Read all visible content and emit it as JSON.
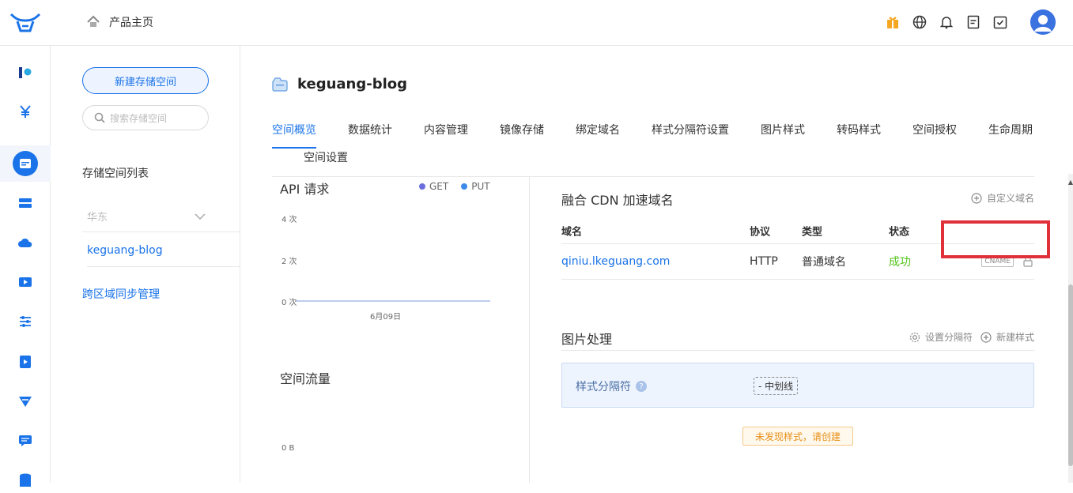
{
  "header": {
    "home_label": "产品主页",
    "icons": [
      "gift-icon",
      "globe-icon",
      "bell-icon",
      "document-icon",
      "task-check-icon",
      "user-avatar"
    ]
  },
  "rail": {
    "icons": [
      "kodo-logo-icon",
      "yuan-icon",
      "storage-icon",
      "server-icon",
      "cloud-icon",
      "video-icon",
      "sliders-icon",
      "media-icon",
      "filter-icon",
      "message-icon",
      "database-icon"
    ]
  },
  "sidebar": {
    "new_bucket_label": "新建存储空间",
    "search_placeholder": "搜索存储空间",
    "list_title": "存储空间列表",
    "region": "华东",
    "bucket": "keguang-blog",
    "cross_region_label": "跨区域同步管理"
  },
  "main": {
    "bucket_title": "keguang-blog",
    "tabs": [
      {
        "label": "空间概览"
      },
      {
        "label": "数据统计"
      },
      {
        "label": "内容管理"
      },
      {
        "label": "镜像存储"
      },
      {
        "label": "绑定域名"
      },
      {
        "label": "样式分隔符设置"
      },
      {
        "label": "图片样式"
      },
      {
        "label": "转码样式"
      },
      {
        "label": "空间授权"
      },
      {
        "label": "生命周期"
      },
      {
        "label": "空间设置"
      }
    ],
    "active_tab": "空间概览"
  },
  "api_chart": {
    "title": "API 请求",
    "legend": [
      {
        "name": "GET",
        "color": "#6b6fdc"
      },
      {
        "name": "PUT",
        "color": "#3d8be8"
      }
    ],
    "y_ticks": [
      "4 次",
      "2 次",
      "0 次"
    ],
    "x_ticks": [
      "6月09日"
    ]
  },
  "traffic_chart": {
    "title": "空间流量",
    "y_ticks": [
      "0 B"
    ]
  },
  "chart_data": [
    {
      "type": "line",
      "title": "API 请求",
      "x": [
        "6月09日"
      ],
      "series": [
        {
          "name": "GET",
          "values": [
            0
          ]
        },
        {
          "name": "PUT",
          "values": [
            0
          ]
        }
      ],
      "ylim": [
        0,
        4
      ],
      "legend": "top-right"
    },
    {
      "type": "line",
      "title": "空间流量",
      "x": [],
      "series": []
    }
  ],
  "cdn": {
    "title": "融合 CDN 加速域名",
    "custom_domain_label": "自定义域名",
    "columns": [
      "域名",
      "协议",
      "类型",
      "状态"
    ],
    "rows": [
      {
        "domain": "qiniu.lkeguang.com",
        "protocol": "HTTP",
        "type": "普通域名",
        "status": "成功",
        "badge": "CNAME"
      }
    ],
    "status_color": "#52c41a"
  },
  "image_processing": {
    "title": "图片处理",
    "set_separator_label": "设置分隔符",
    "new_style_label": "新建样式",
    "separator_label": "样式分隔符",
    "separator_value": "- 中划线",
    "empty_hint": "未发现样式，请创建"
  }
}
